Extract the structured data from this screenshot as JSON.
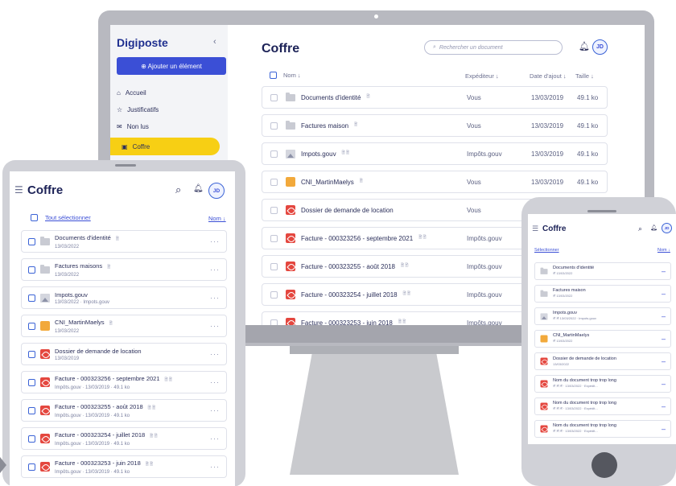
{
  "desktop": {
    "logo": "Digiposte",
    "add_button": "⊕ Ajouter un élément",
    "nav": [
      {
        "label": "Accueil",
        "icon": "home-icon"
      },
      {
        "label": "Justificatifs",
        "icon": "star-icon"
      },
      {
        "label": "Non lus",
        "icon": "mail-icon"
      },
      {
        "label": "Coffre",
        "icon": "safe-icon"
      }
    ],
    "title": "Coffre",
    "search_placeholder": "Rechercher un document",
    "avatar": "JD",
    "columns": {
      "name": "Nom ↓",
      "sender": "Expéditeur ↓",
      "date": "Date d'ajout ↓",
      "size": "Taille ↓"
    },
    "rows": [
      {
        "icon": "folder",
        "name": "Documents d'identité",
        "badge": "🖹",
        "sender": "Vous",
        "date": "13/03/2019",
        "size": "49.1 ko"
      },
      {
        "icon": "folder",
        "name": "Factures maison",
        "badge": "🖹",
        "sender": "Vous",
        "date": "13/03/2019",
        "size": "49.1 ko"
      },
      {
        "icon": "image",
        "name": "Impots.gouv",
        "badge": "🗎 🖹",
        "sender": "Impôts.gouv",
        "date": "13/03/2019",
        "size": "49.1 ko"
      },
      {
        "icon": "id",
        "name": "CNI_MartinMaelys",
        "badge": "🖹",
        "sender": "Vous",
        "date": "13/03/2019",
        "size": "49.1 ko"
      },
      {
        "icon": "pdf",
        "name": "Dossier de demande de location",
        "badge": "",
        "sender": "Vous",
        "date": "",
        "size": ""
      },
      {
        "icon": "pdf",
        "name": "Facture - 000323256 - septembre 2021",
        "badge": "🗎 🖹",
        "sender": "Impôts.gouv",
        "date": "",
        "size": ""
      },
      {
        "icon": "pdf",
        "name": "Facture - 000323255 - août 2018",
        "badge": "🗎 🖹",
        "sender": "Impôts.gouv",
        "date": "",
        "size": ""
      },
      {
        "icon": "pdf",
        "name": "Facture - 000323254 - juillet 2018",
        "badge": "🗎 🖹",
        "sender": "Impôts.gouv",
        "date": "",
        "size": ""
      },
      {
        "icon": "pdf",
        "name": "Facture - 000323253 - juin 2018",
        "badge": "🗎 🖹",
        "sender": "Impôts.gouv",
        "date": "",
        "size": ""
      }
    ]
  },
  "tablet": {
    "title": "Coffre",
    "avatar": "JD",
    "select_all": "Tout sélectionner",
    "sort": "Nom ↓",
    "rows": [
      {
        "icon": "folder",
        "name": "Documents d'identité",
        "badge": "🖹",
        "sub": "13/03/2022"
      },
      {
        "icon": "folder",
        "name": "Factures maisons",
        "badge": "🖹",
        "sub": "13/03/2022"
      },
      {
        "icon": "image",
        "name": "Impots.gouv",
        "badge": "",
        "sub": "13/03/2022 · Impots.gouv"
      },
      {
        "icon": "id",
        "name": "CNI_MartinMaelys",
        "badge": "🖹",
        "sub": "13/03/2022"
      },
      {
        "icon": "pdf",
        "name": "Dossier de demande de location",
        "badge": "",
        "sub": "13/03/2019"
      },
      {
        "icon": "pdf",
        "name": "Facture - 000323256 - septembre 2021",
        "badge": "🗎 🖹",
        "sub": "Impôts.gouv · 13/03/2019 · 49.1 ko"
      },
      {
        "icon": "pdf",
        "name": "Facture - 000323255 - août 2018",
        "badge": "🗎 🖹",
        "sub": "Impôts.gouv · 13/03/2019 · 49.1 ko"
      },
      {
        "icon": "pdf",
        "name": "Facture - 000323254 - juillet 2018",
        "badge": "🗎 🖹",
        "sub": "Impôts.gouv · 13/03/2019 · 49.1 ko"
      },
      {
        "icon": "pdf",
        "name": "Facture - 000323253 - juin 2018",
        "badge": "🗎 🖹",
        "sub": "Impôts.gouv · 13/03/2019 · 49.1 ko"
      }
    ]
  },
  "phone": {
    "title": "Coffre",
    "avatar": "JD",
    "select": "Sélectionner",
    "sort": "Nom ↓",
    "rows": [
      {
        "icon": "folder",
        "name": "Documents d'identité",
        "sub": "🖹 13/03/2022"
      },
      {
        "icon": "folder",
        "name": "Factures maison",
        "sub": "🖹 13/03/2022"
      },
      {
        "icon": "image",
        "name": "Impots.gouv",
        "sub": "🖹 🗎 13/03/2022 · Impots.gouv"
      },
      {
        "icon": "id",
        "name": "CNI_MartinMaelys",
        "sub": "🖹 13/03/2022"
      },
      {
        "icon": "pdf",
        "name": "Dossier de demande de location",
        "sub": "13/03/2022"
      },
      {
        "icon": "pdf",
        "name": "Nom du document trop trop long",
        "sub": "🖹 🗎 🗎 · 13/03/2022 · Expédit..."
      },
      {
        "icon": "pdf",
        "name": "Nom du document trop trop long",
        "sub": "🖹 🗎 🗎 · 13/03/2022 · Expédit..."
      },
      {
        "icon": "pdf",
        "name": "Nom du document trop trop long",
        "sub": "🖹 🗎 🗎 · 13/03/2022 · Expédit..."
      }
    ]
  }
}
